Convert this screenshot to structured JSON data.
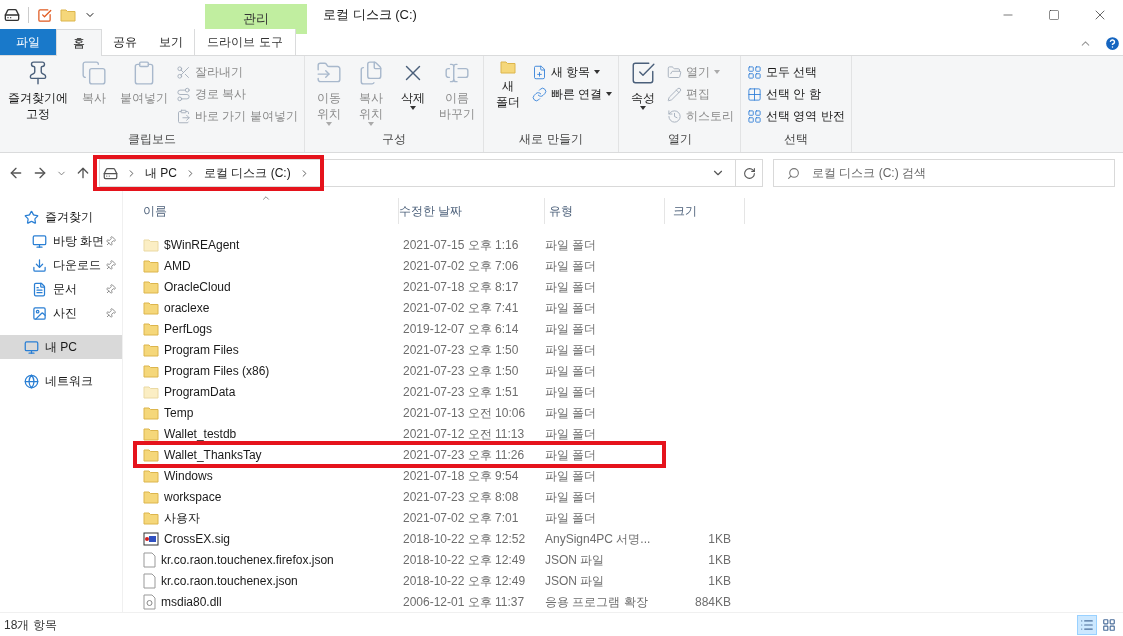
{
  "window": {
    "title": "로컬 디스크 (C:)",
    "context_tab_group": "관리"
  },
  "ribbon_tabs": [
    {
      "label": "파일",
      "kind": "file"
    },
    {
      "label": "홈",
      "kind": "tab",
      "selected": true
    },
    {
      "label": "공유",
      "kind": "tab",
      "selected": false
    },
    {
      "label": "보기",
      "kind": "tab",
      "selected": false
    },
    {
      "label": "드라이브 도구",
      "kind": "context",
      "selected": false
    }
  ],
  "ribbon_groups": [
    {
      "title": "클립보드",
      "items": [
        {
          "kind": "large",
          "lines": [
            "즐겨찾기에",
            "고정"
          ],
          "disabled": false
        },
        {
          "kind": "large",
          "lines": [
            "복사"
          ],
          "disabled": true
        },
        {
          "kind": "large",
          "lines": [
            "붙여넣기"
          ],
          "disabled": true
        },
        {
          "kind": "stack",
          "items": [
            {
              "label": "잘라내기",
              "disabled": true
            },
            {
              "label": "경로 복사",
              "disabled": true
            },
            {
              "label": "바로 가기 붙여넣기",
              "disabled": true
            }
          ]
        }
      ]
    },
    {
      "title": "구성",
      "items": [
        {
          "kind": "large",
          "lines": [
            "이동",
            "위치"
          ],
          "disabled": true,
          "dropdown": true
        },
        {
          "kind": "large",
          "lines": [
            "복사",
            "위치"
          ],
          "disabled": true,
          "dropdown": true
        },
        {
          "kind": "large",
          "lines": [
            "삭제"
          ],
          "disabled": false,
          "dropdown": true
        },
        {
          "kind": "large",
          "lines": [
            "이름",
            "바꾸기"
          ],
          "disabled": true
        }
      ]
    },
    {
      "title": "새로 만들기",
      "items": [
        {
          "kind": "large",
          "lines": [
            "새",
            "폴더"
          ],
          "disabled": false
        },
        {
          "kind": "stack",
          "items": [
            {
              "label": "새 항목",
              "disabled": false,
              "dropdown": true
            },
            {
              "label": "빠른 연결",
              "disabled": false,
              "dropdown": true
            }
          ]
        }
      ]
    },
    {
      "title": "열기",
      "items": [
        {
          "kind": "large",
          "lines": [
            "속성"
          ],
          "disabled": false,
          "dropdown": true
        },
        {
          "kind": "stack",
          "items": [
            {
              "label": "열기",
              "disabled": true,
              "dropdown": true
            },
            {
              "label": "편집",
              "disabled": true
            },
            {
              "label": "히스토리",
              "disabled": true
            }
          ]
        }
      ]
    },
    {
      "title": "선택",
      "items": [
        {
          "kind": "stack",
          "items": [
            {
              "label": "모두 선택",
              "disabled": false
            },
            {
              "label": "선택 안 함",
              "disabled": false
            },
            {
              "label": "선택 영역 반전",
              "disabled": false
            }
          ]
        }
      ]
    }
  ],
  "address_bar": {
    "crumbs": [
      "내 PC",
      "로컬 디스크 (C:)"
    ],
    "highlighted": true
  },
  "search": {
    "placeholder": "로컬 디스크 (C:) 검색"
  },
  "sidebar": {
    "items": [
      {
        "label": "즐겨찾기",
        "kind": "quick",
        "selected": false,
        "children": [
          {
            "label": "바탕 화면",
            "pinned": true,
            "selected": false
          },
          {
            "label": "다운로드",
            "pinned": true,
            "selected": false
          },
          {
            "label": "문서",
            "pinned": true,
            "selected": false
          },
          {
            "label": "사진",
            "pinned": true,
            "selected": false
          }
        ]
      },
      {
        "label": "내 PC",
        "kind": "pc",
        "selected": true
      },
      {
        "label": "네트워크",
        "kind": "network",
        "selected": false
      }
    ]
  },
  "table": {
    "columns": [
      "이름",
      "수정한 날짜",
      "유형",
      "크기"
    ],
    "rows": [
      {
        "name": "$WinREAgent",
        "date": "2021-07-15 오후 1:16",
        "type": "파일 폴더",
        "kind": "folder",
        "hidden": true,
        "highlighted": false
      },
      {
        "name": "AMD",
        "date": "2021-07-02 오후 7:06",
        "type": "파일 폴더",
        "kind": "folder",
        "hidden": false,
        "highlighted": false
      },
      {
        "name": "OracleCloud",
        "date": "2021-07-18 오후 8:17",
        "type": "파일 폴더",
        "kind": "folder",
        "hidden": false,
        "highlighted": false
      },
      {
        "name": "oraclexe",
        "date": "2021-07-02 오후 7:41",
        "type": "파일 폴더",
        "kind": "folder",
        "hidden": false,
        "highlighted": false
      },
      {
        "name": "PerfLogs",
        "date": "2019-12-07 오후 6:14",
        "type": "파일 폴더",
        "kind": "folder",
        "hidden": false,
        "highlighted": false
      },
      {
        "name": "Program Files",
        "date": "2021-07-23 오후 1:50",
        "type": "파일 폴더",
        "kind": "folder",
        "hidden": false,
        "highlighted": false
      },
      {
        "name": "Program Files (x86)",
        "date": "2021-07-23 오후 1:50",
        "type": "파일 폴더",
        "kind": "folder",
        "hidden": false,
        "highlighted": false
      },
      {
        "name": "ProgramData",
        "date": "2021-07-23 오후 1:51",
        "type": "파일 폴더",
        "kind": "folder",
        "hidden": true,
        "highlighted": false
      },
      {
        "name": "Temp",
        "date": "2021-07-13 오전 10:06",
        "type": "파일 폴더",
        "kind": "folder",
        "hidden": false,
        "highlighted": false
      },
      {
        "name": "Wallet_testdb",
        "date": "2021-07-12 오전 11:13",
        "type": "파일 폴더",
        "kind": "folder",
        "hidden": false,
        "highlighted": false
      },
      {
        "name": "Wallet_ThanksTay",
        "date": "2021-07-23 오후 11:26",
        "type": "파일 폴더",
        "kind": "folder",
        "hidden": false,
        "highlighted": true
      },
      {
        "name": "Windows",
        "date": "2021-07-18 오후 9:54",
        "type": "파일 폴더",
        "kind": "folder",
        "hidden": false,
        "highlighted": false
      },
      {
        "name": "workspace",
        "date": "2021-07-23 오후 8:08",
        "type": "파일 폴더",
        "kind": "folder",
        "hidden": false,
        "highlighted": false
      },
      {
        "name": "사용자",
        "date": "2021-07-02 오후 7:01",
        "type": "파일 폴더",
        "kind": "folder",
        "hidden": false,
        "highlighted": false
      },
      {
        "name": "CrossEX.sig",
        "date": "2018-10-22 오후 12:52",
        "type": "AnySign4PC 서명...",
        "size": "1KB",
        "kind": "sig",
        "highlighted": false
      },
      {
        "name": "kr.co.raon.touchenex.firefox.json",
        "date": "2018-10-22 오후 12:49",
        "type": "JSON 파일",
        "size": "1KB",
        "kind": "file",
        "highlighted": false
      },
      {
        "name": "kr.co.raon.touchenex.json",
        "date": "2018-10-22 오후 12:49",
        "type": "JSON 파일",
        "size": "1KB",
        "kind": "file",
        "highlighted": false
      },
      {
        "name": "msdia80.dll",
        "date": "2006-12-01 오후 11:37",
        "type": "응용 프로그램 확장",
        "size": "884KB",
        "kind": "dll",
        "highlighted": false
      }
    ]
  },
  "status_bar": {
    "count": "18개 항목",
    "views": [
      {
        "kind": "details",
        "selected": true
      },
      {
        "kind": "large",
        "selected": false
      }
    ]
  }
}
